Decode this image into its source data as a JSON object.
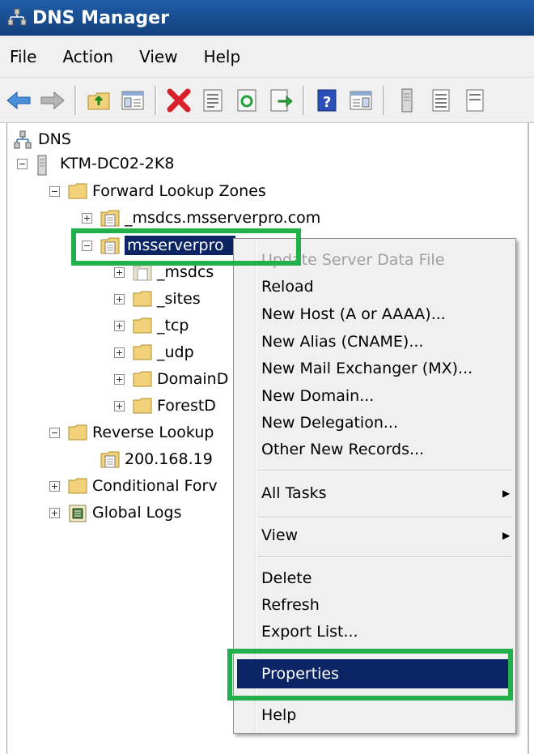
{
  "window": {
    "title": "DNS Manager"
  },
  "menubar": {
    "items": [
      "File",
      "Action",
      "View",
      "Help"
    ]
  },
  "toolbar": {
    "icons": [
      "back-icon",
      "forward-icon",
      "up-folder-icon",
      "show-hide-tree-icon",
      "delete-icon",
      "properties-icon",
      "refresh-icon",
      "export-list-icon",
      "help-icon",
      "show-hide-action-pane-icon",
      "server-icon",
      "list-icon",
      "details-icon"
    ]
  },
  "tree": {
    "root": "DNS",
    "server": "KTM-DC02-2K8",
    "forward_zones": "Forward Lookup Zones",
    "msdcs_zone": "_msdcs.msserverpro.com",
    "selected_zone": "msserverpro",
    "children": [
      "_msdcs",
      "_sites",
      "_tcp",
      "_udp",
      "DomainD",
      "ForestD"
    ],
    "reverse_zones": "Reverse Lookup",
    "reverse_child": "200.168.19",
    "conditional": "Conditional Forv",
    "global_logs": "Global Logs"
  },
  "context_menu": {
    "update": "Update Server Data File",
    "reload": "Reload",
    "new_host": "New Host (A or AAAA)...",
    "new_alias": "New Alias (CNAME)...",
    "new_mx": "New Mail Exchanger (MX)...",
    "new_domain": "New Domain...",
    "new_delegation": "New Delegation...",
    "other_records": "Other New Records...",
    "all_tasks": "All Tasks",
    "view": "View",
    "delete": "Delete",
    "refresh": "Refresh",
    "export": "Export List...",
    "properties": "Properties",
    "help": "Help",
    "arrow": "▶"
  },
  "colors": {
    "highlight": "#0a2464",
    "callout": "#22b04c",
    "folder": "#f1d27a"
  }
}
